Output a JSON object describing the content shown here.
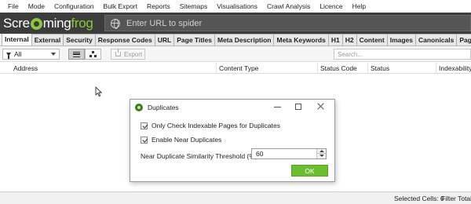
{
  "menu": [
    "File",
    "Mode",
    "Configuration",
    "Bulk Export",
    "Reports",
    "Sitemaps",
    "Visualisations",
    "Crawl Analysis",
    "Licence",
    "Help"
  ],
  "brand": {
    "part1": "Scre",
    "part2": "ming",
    "part3": "frog"
  },
  "url_bar": {
    "placeholder": "Enter URL to spider"
  },
  "tabs": [
    "Internal",
    "External",
    "Security",
    "Response Codes",
    "URL",
    "Page Titles",
    "Meta Description",
    "Meta Keywords",
    "H1",
    "H2",
    "Content",
    "Images",
    "Canonicals",
    "Pagination"
  ],
  "active_tab": "Internal",
  "toolbar": {
    "filter_value": "All",
    "export_label": "Export",
    "search_placeholder": "Search..."
  },
  "columns": [
    "Address",
    "Content Type",
    "Status Code",
    "Status",
    "Indexability"
  ],
  "dialog": {
    "title": "Duplicates",
    "option_indexable": "Only Check Indexable Pages for Duplicates",
    "option_indexable_checked": true,
    "option_near_dup": "Enable Near Duplicates",
    "option_near_dup_checked": true,
    "threshold_label": "Near Duplicate Similarity Threshold (%)",
    "threshold_value": "60",
    "ok_label": "OK"
  },
  "status": {
    "selected_cells": "Selected Cells: 0",
    "filter_total": "Filter Total:"
  },
  "colors": {
    "brand_green": "#8dc63f",
    "ok_green": "#6cbd2f",
    "brand_bar": "#3c3c3c"
  }
}
